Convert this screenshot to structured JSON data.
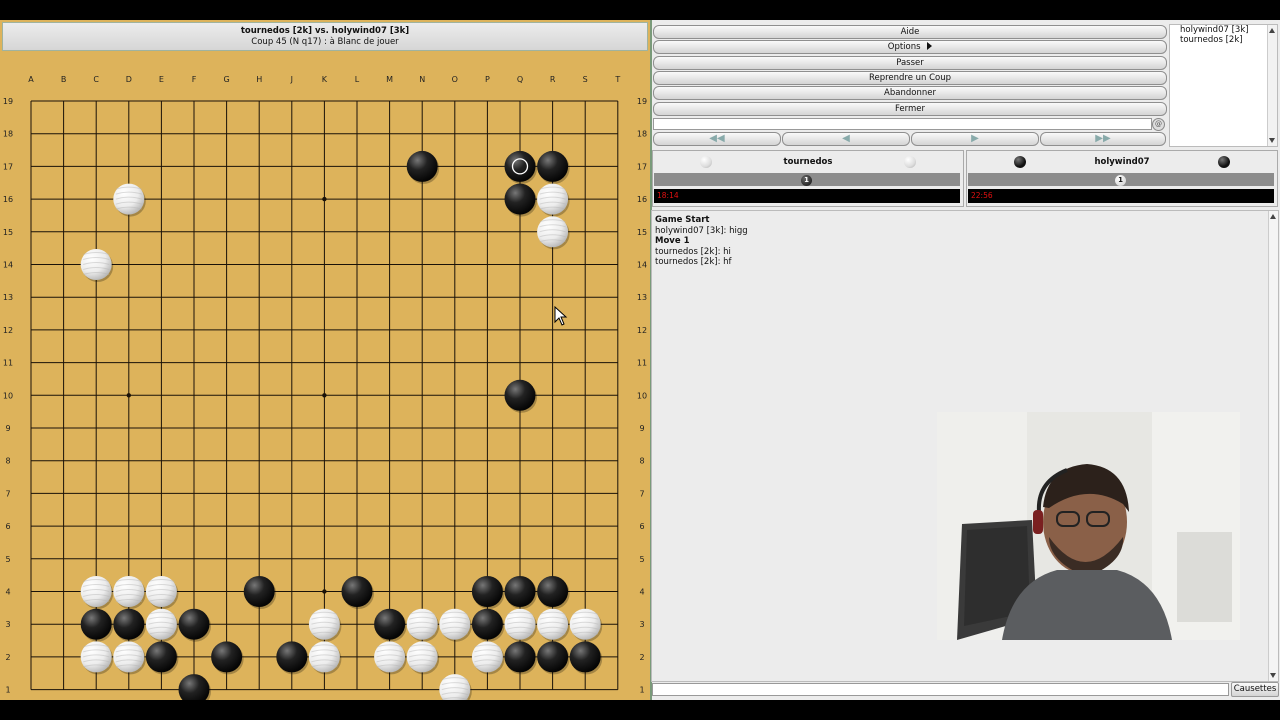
{
  "board": {
    "header_title": "tournedos [2k] vs. holywind07 [3k]",
    "header_status": "Coup 45 (N q17) : à Blanc de jouer",
    "columns": [
      "A",
      "B",
      "C",
      "D",
      "E",
      "F",
      "G",
      "H",
      "J",
      "K",
      "L",
      "M",
      "N",
      "O",
      "P",
      "Q",
      "R",
      "S",
      "T"
    ],
    "rows": [
      "19",
      "18",
      "17",
      "16",
      "15",
      "14",
      "13",
      "12",
      "11",
      "10",
      "9",
      "8",
      "7",
      "6",
      "5",
      "4",
      "3",
      "2",
      "1"
    ],
    "last_move": "Q17",
    "stones": [
      {
        "color": "black",
        "pt": "N17"
      },
      {
        "color": "black",
        "pt": "Q17"
      },
      {
        "color": "black",
        "pt": "R17"
      },
      {
        "color": "black",
        "pt": "Q16"
      },
      {
        "color": "white",
        "pt": "D16"
      },
      {
        "color": "white",
        "pt": "R16"
      },
      {
        "color": "white",
        "pt": "R15"
      },
      {
        "color": "white",
        "pt": "C14"
      },
      {
        "color": "black",
        "pt": "Q10"
      },
      {
        "color": "white",
        "pt": "C4"
      },
      {
        "color": "white",
        "pt": "D4"
      },
      {
        "color": "white",
        "pt": "E4"
      },
      {
        "color": "black",
        "pt": "H4"
      },
      {
        "color": "black",
        "pt": "L4"
      },
      {
        "color": "black",
        "pt": "P4"
      },
      {
        "color": "black",
        "pt": "Q4"
      },
      {
        "color": "black",
        "pt": "R4"
      },
      {
        "color": "black",
        "pt": "C3"
      },
      {
        "color": "black",
        "pt": "D3"
      },
      {
        "color": "white",
        "pt": "E3"
      },
      {
        "color": "black",
        "pt": "F3"
      },
      {
        "color": "white",
        "pt": "K3"
      },
      {
        "color": "black",
        "pt": "M3"
      },
      {
        "color": "white",
        "pt": "N3"
      },
      {
        "color": "white",
        "pt": "O3"
      },
      {
        "color": "black",
        "pt": "P3"
      },
      {
        "color": "white",
        "pt": "Q3"
      },
      {
        "color": "white",
        "pt": "R3"
      },
      {
        "color": "white",
        "pt": "S3"
      },
      {
        "color": "white",
        "pt": "C2"
      },
      {
        "color": "white",
        "pt": "D2"
      },
      {
        "color": "black",
        "pt": "E2"
      },
      {
        "color": "black",
        "pt": "G2"
      },
      {
        "color": "black",
        "pt": "J2"
      },
      {
        "color": "white",
        "pt": "K2"
      },
      {
        "color": "white",
        "pt": "M2"
      },
      {
        "color": "white",
        "pt": "N2"
      },
      {
        "color": "white",
        "pt": "P2"
      },
      {
        "color": "black",
        "pt": "Q2"
      },
      {
        "color": "black",
        "pt": "R2"
      },
      {
        "color": "black",
        "pt": "S2"
      },
      {
        "color": "black",
        "pt": "F1"
      },
      {
        "color": "white",
        "pt": "O1"
      }
    ]
  },
  "buttons": {
    "help": "Aide",
    "options": "Options",
    "pass": "Passer",
    "undo": "Reprendre un Coup",
    "resign": "Abandonner",
    "close": "Fermer"
  },
  "navigation": {
    "first": "◀◀",
    "prev": "◀",
    "next": "▶",
    "last": "▶▶"
  },
  "players_list": [
    "holywind07 [3k]",
    "tournedos [2k]"
  ],
  "white_player": {
    "name": "tournedos",
    "captures": "1",
    "clock": "18:14"
  },
  "black_player": {
    "name": "holywind07",
    "captures": "1",
    "clock": "22:56"
  },
  "chat": [
    {
      "text": "Game Start",
      "bold": true
    },
    {
      "text": "holywind07 [3k]: higg",
      "bold": false
    },
    {
      "text": "Move 1",
      "bold": true
    },
    {
      "text": "tournedos [2k]: hi",
      "bold": false
    },
    {
      "text": "tournedos [2k]: hf",
      "bold": false
    }
  ],
  "chat_send_label": "Causettes",
  "icons": [
    "mouse-cursor-icon",
    "command-icon",
    "scroll-up-icon",
    "scroll-down-icon"
  ],
  "colors": {
    "board": "#ddb35b",
    "clock_text": "#e01010",
    "frame": "#7a9a7a"
  }
}
